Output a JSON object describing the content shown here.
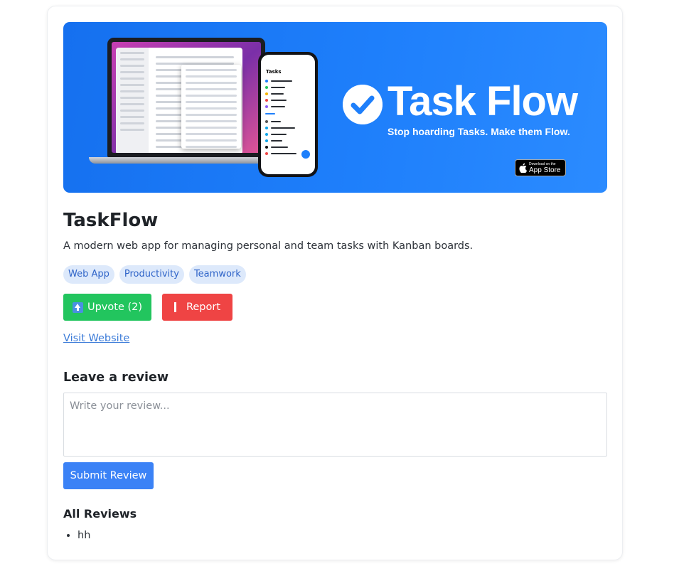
{
  "banner": {
    "brand_name": "Task Flow",
    "tagline": "Stop hoarding Tasks. Make them Flow.",
    "app_store_small": "Download on the",
    "app_store_big": "App Store",
    "phone_title": "Tasks",
    "background_color": "#1e7ffb"
  },
  "app": {
    "name": "TaskFlow",
    "description": "A modern web app for managing personal and team tasks with Kanban boards.",
    "tags": [
      "Web App",
      "Productivity",
      "Teamwork"
    ]
  },
  "actions": {
    "upvote_label": "Upvote (2)",
    "report_label": "Report",
    "upvote_color": "#22c55e",
    "report_color": "#ef4444",
    "visit_label": "Visit Website"
  },
  "review_form": {
    "heading": "Leave a review",
    "placeholder": "Write your review...",
    "submit_label": "Submit Review"
  },
  "reviews": {
    "heading": "All Reviews",
    "items": [
      "hh"
    ]
  }
}
